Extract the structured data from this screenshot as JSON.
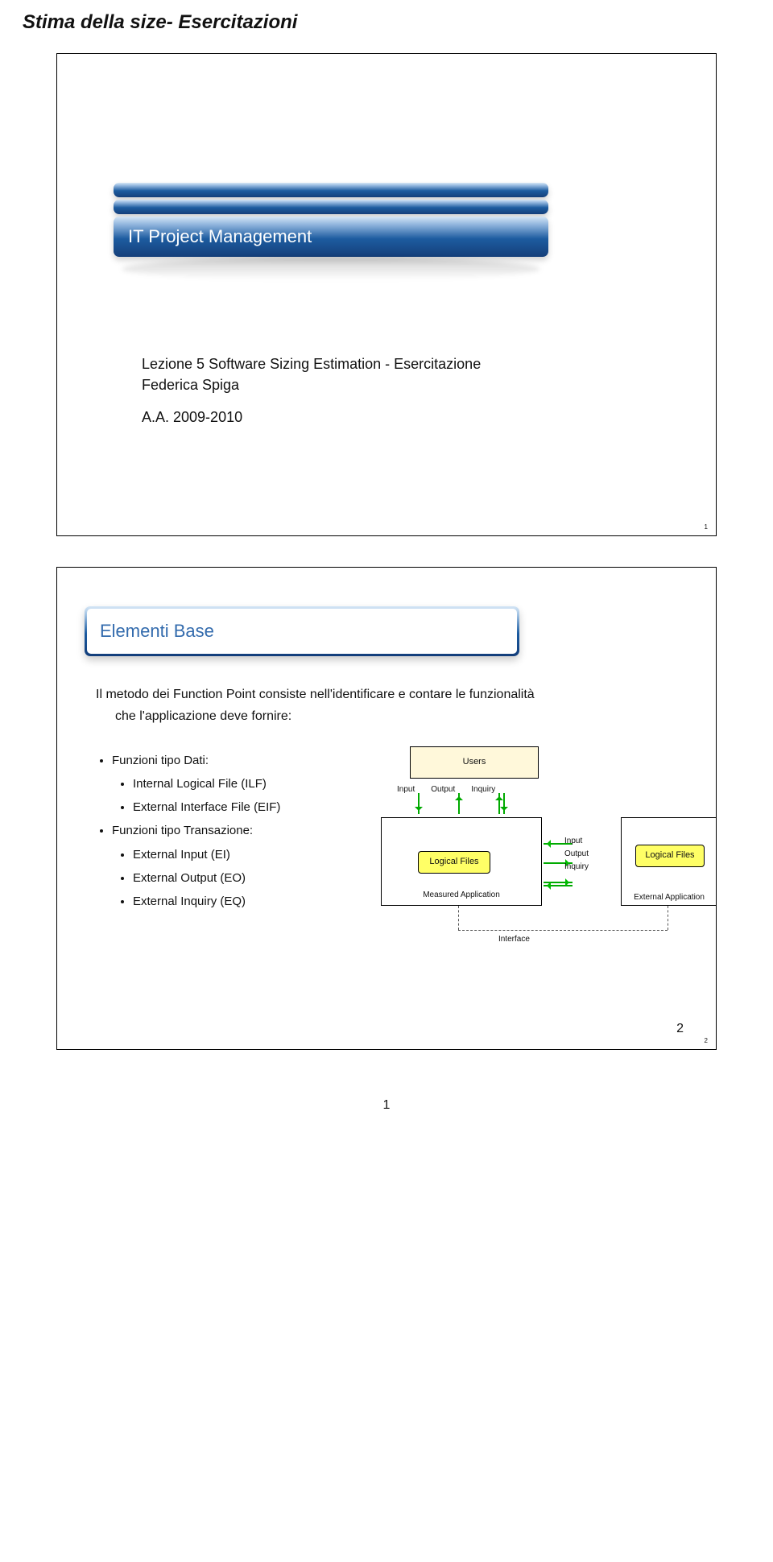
{
  "page_header": "Stima della size- Esercitazioni",
  "slide1": {
    "title": "IT Project Management",
    "subtitle_line1": "Lezione 5 Software Sizing Estimation - Esercitazione",
    "subtitle_line2": "Federica Spiga",
    "subtitle_line3": "A.A. 2009-2010",
    "slidenum": "1"
  },
  "slide2": {
    "title": "Elementi Base",
    "intro_line1": "Il metodo dei Function Point consiste nell'identificare e contare le funzionalità",
    "intro_line2": "che l'applicazione deve fornire:",
    "list": {
      "l1": "Funzioni tipo Dati:",
      "l1a": "Internal Logical File (ILF)",
      "l1b": "External Interface File (EIF)",
      "l2": "Funzioni tipo Transazione:",
      "l2a": "External Input (EI)",
      "l2b": "External Output (EO)",
      "l2c": "External Inquiry (EQ)"
    },
    "diagram": {
      "users": "Users",
      "io_input": "Input",
      "io_output": "Output",
      "io_inquiry": "Inquiry",
      "logical_files": "Logical Files",
      "measured": "Measured Application",
      "mid_input": "Input",
      "mid_output": "Output",
      "mid_inquiry": "Inquiry",
      "external_app": "External Application",
      "interface": "Interface"
    },
    "pagenum": "2",
    "slidenum": "2"
  },
  "footer_pagenum": "1"
}
